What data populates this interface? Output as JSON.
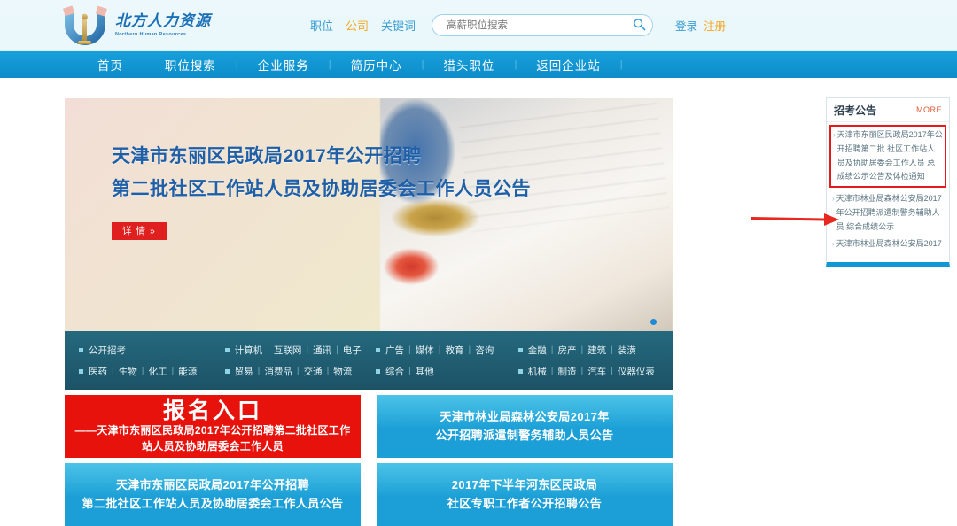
{
  "header": {
    "logo_cn": "北方人力资源",
    "logo_en": "Northern Human Resources",
    "search_tabs": [
      {
        "label": "职位",
        "active": false
      },
      {
        "label": "公司",
        "active": true
      },
      {
        "label": "关键词",
        "active": false
      }
    ],
    "search": {
      "placeholder": "高薪职位搜索",
      "value": "",
      "icon": "search-icon"
    },
    "auth": {
      "login": "登录",
      "register": "注册"
    }
  },
  "nav": {
    "items": [
      "首页",
      "职位搜索",
      "企业服务",
      "简历中心",
      "猎头职位",
      "返回企业站"
    ],
    "separator": "|"
  },
  "banner": {
    "line1": "天津市东丽区民政局2017年公开招聘",
    "line2": "第二批社区工作站人员及协助居委会工作人员公告",
    "cta_label": "详 情",
    "cta_arrow": "»",
    "carousel_dot": "•"
  },
  "categories": {
    "columns": [
      {
        "rows": [
          [
            "公开招考"
          ],
          [
            "医药",
            "生物",
            "化工",
            "能源"
          ]
        ]
      },
      {
        "rows": [
          [
            "计算机",
            "互联网",
            "通讯",
            "电子"
          ],
          [
            "贸易",
            "消费品",
            "交通",
            "物流"
          ]
        ]
      },
      {
        "rows": [
          [
            "广告",
            "媒体",
            "教育",
            "咨询"
          ],
          [
            "综合",
            "其他"
          ]
        ]
      },
      {
        "rows": [
          [
            "金融",
            "房产",
            "建筑",
            "装潢"
          ],
          [
            "机械",
            "制造",
            "汽车",
            "仪器仪表"
          ]
        ]
      }
    ],
    "divider": "|"
  },
  "sidebar": {
    "title": "招考公告",
    "more_label": "MORE",
    "arrow_glyph": "›",
    "news": [
      {
        "text": "天津市东丽区民政局2017年公开招聘第二批 社区工作站人员及协助居委会工作人员 总成绩公示公告及体检通知",
        "highlighted": true
      },
      {
        "text": "天津市林业局森林公安局2017年公开招聘派遣制警务辅助人员 综合成绩公示",
        "highlighted": false
      },
      {
        "text": "天津市林业局森林公安局2017年",
        "highlighted": false
      }
    ]
  },
  "annotation": {
    "arrow_color": "#e8281e",
    "description": "red-arrow-pointing-to-first-news-item"
  },
  "cards": [
    {
      "style": "red",
      "title": "报名入口",
      "sub1": "——天津市东丽区民政局2017年公开招聘第二批社区工作",
      "sub2": "站人员及协助居委会工作人员"
    },
    {
      "style": "blue",
      "line1": "天津市林业局森林公安局2017年",
      "line2": "公开招聘派遣制警务辅助人员公告"
    },
    {
      "style": "blue",
      "line1": "天津市东丽区民政局2017年公开招聘",
      "line2": "第二批社区工作站人员及协助居委会工作人员公告"
    },
    {
      "style": "blue",
      "line1": "2017年下半年河东区民政局",
      "line2": "社区专职工作者公开招聘公告"
    }
  ],
  "colors": {
    "nav_blue": "#1197d4",
    "header_bg": "#eef9fc",
    "accent_orange": "#f5a623",
    "card_red": "#e8120c",
    "card_blue": "#1b9fd6",
    "cat_strip": "#1f5f73",
    "annotation_red": "#e8281e"
  }
}
